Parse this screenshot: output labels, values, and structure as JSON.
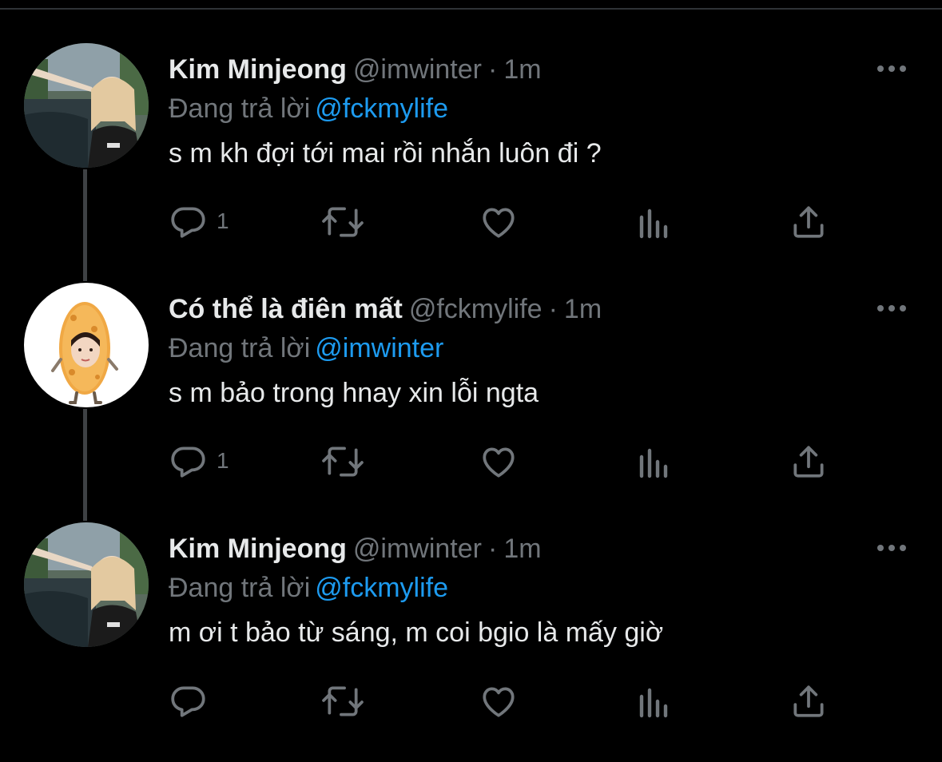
{
  "replying_label": "Đang trả lời",
  "theme": {
    "background": "#000000",
    "text": "#e7e9ea",
    "muted": "#71767b",
    "link": "#1d9bf0",
    "thread_line": "#3e4144"
  },
  "icons": [
    "more-icon",
    "reply-icon",
    "retweet-icon",
    "like-icon",
    "views-icon",
    "share-icon"
  ],
  "tweets": [
    {
      "name": "Kim Minjeong",
      "handle": "@imwinter",
      "separator": "·",
      "time": "1m",
      "replying_to": "@fckmylife",
      "text": "s m kh đợi tới mai rồi nhắn luôn đi ?",
      "reply_count": "1"
    },
    {
      "name": "Có thể là điên mất",
      "handle": "@fckmylife",
      "separator": "·",
      "time": "1m",
      "replying_to": "@imwinter",
      "text": "s m bảo trong hnay xin lỗi ngta",
      "reply_count": "1"
    },
    {
      "name": "Kim Minjeong",
      "handle": "@imwinter",
      "separator": "·",
      "time": "1m",
      "replying_to": "@fckmylife",
      "text": "m ơi t bảo từ sáng, m coi bgio là mấy giờ",
      "reply_count": ""
    }
  ]
}
